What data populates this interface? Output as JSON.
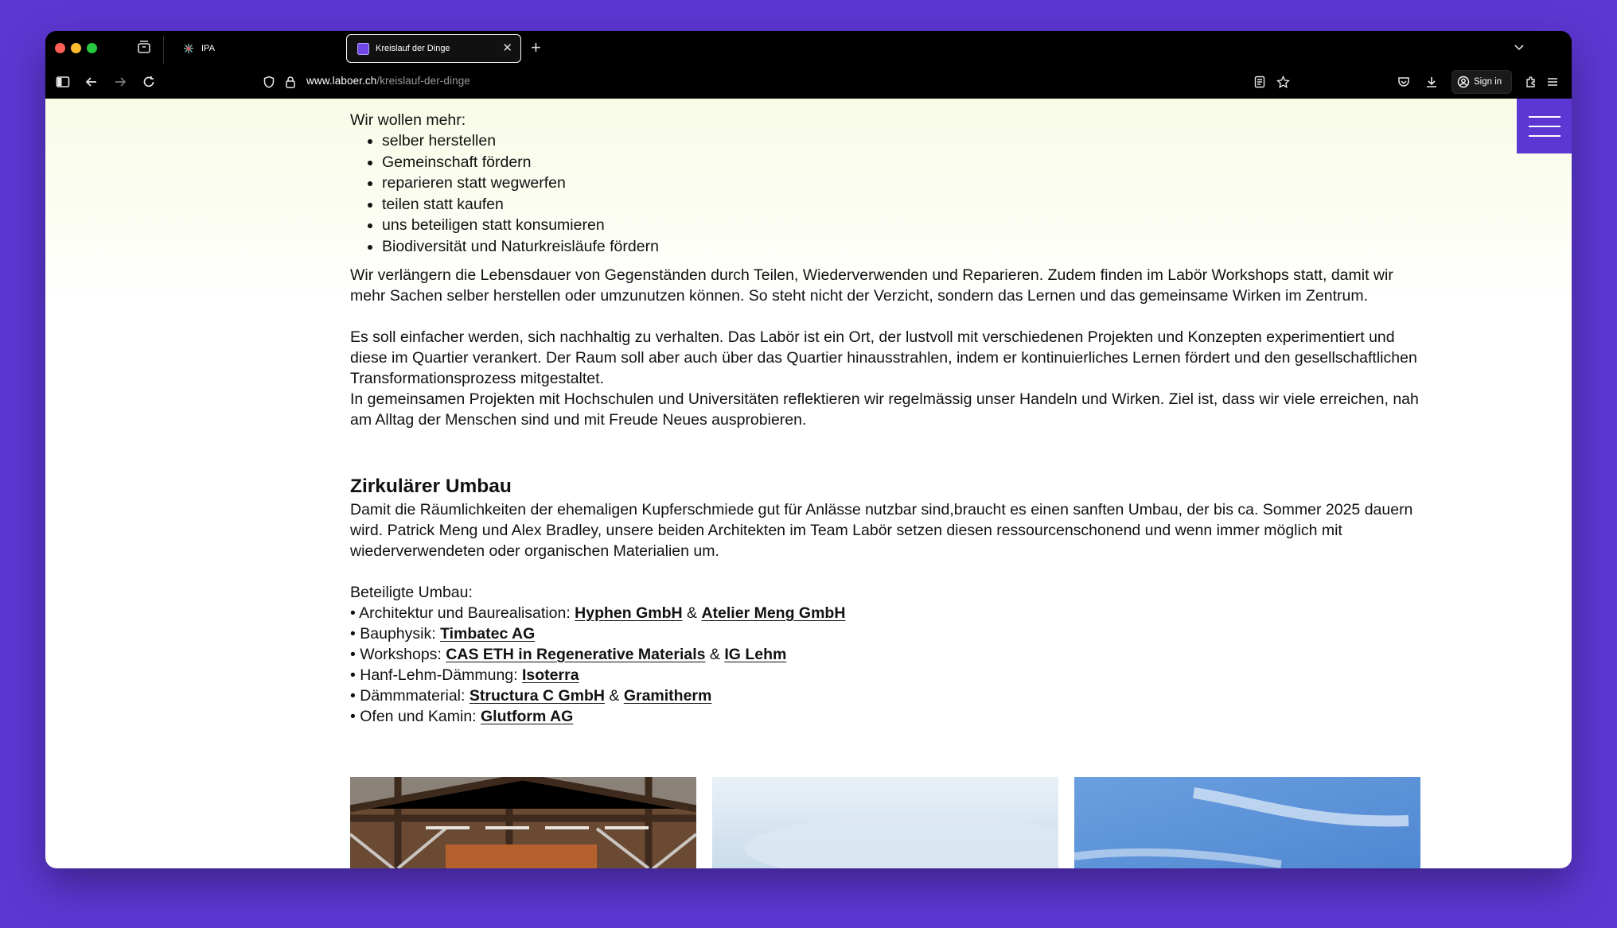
{
  "browser": {
    "tabs": [
      {
        "label": "IPA",
        "favicon": "sparkle-icon"
      },
      {
        "label": "Kreislauf der Dinge",
        "favicon": "purple-square-icon",
        "active": true
      }
    ],
    "url_domain": "www.laboer.ch",
    "url_path": "/kreislauf-der-dinge",
    "signin_label": "Sign in"
  },
  "content": {
    "intro_label": "Wir wollen mehr:",
    "goals": [
      "selber herstellen",
      "Gemeinschaft fördern",
      "reparieren statt wegwerfen",
      "teilen statt kaufen",
      "uns beteiligen statt konsumieren",
      "Biodiversität und Naturkreisläufe fördern"
    ],
    "para1": "Wir verlängern die Lebensdauer von Gegenständen durch Teilen, Wiederverwenden und Reparieren. Zudem finden im Labör Workshops statt, damit wir mehr Sachen selber herstellen oder umzunutzen können. So steht nicht der Verzicht, sondern das Lernen und das gemeinsame Wirken im Zentrum.",
    "para2": "Es soll einfacher werden, sich nachhaltig zu verhalten. Das Labör ist ein Ort, der lustvoll mit verschiedenen Projekten und Konzepten experimentiert und diese im Quartier verankert. Der Raum soll aber auch über das Quartier hinausstrahlen, indem er kontinuierliches Lernen fördert und den gesellschaftlichen Transformationsprozess mitgestaltet.",
    "para3": "In gemeinsamen Projekten mit Hochschulen und Universitäten reflektieren wir regelmässig unser Handeln und Wirken. Ziel ist, dass wir viele erreichen, nah am Alltag der Menschen sind und mit Freude Neues ausprobieren.",
    "heading": "Zirkulärer Umbau",
    "para4": "Damit die Räumlichkeiten der ehemaligen Kupferschmiede gut für Anlässe nutzbar sind,braucht es einen sanften Umbau, der bis ca. Sommer 2025 dauern wird. Patrick Meng und Alex Bradley, unsere beiden Architekten im Team Labör setzen diesen ressourcenschonend und wenn immer möglich mit wiederverwendeten oder organischen Materialien um.",
    "participants_label": "Beteiligte Umbau:",
    "bullet": "•",
    "amp": "&",
    "participants": [
      {
        "prefix": "Architektur und Baurealisation:",
        "links": [
          "Hyphen GmbH",
          "Atelier Meng GmbH"
        ]
      },
      {
        "prefix": "Bauphysik:",
        "links": [
          "Timbatec AG"
        ]
      },
      {
        "prefix": "Workshops:",
        "links": [
          "CAS ETH in Regenerative Materials",
          "IG Lehm"
        ]
      },
      {
        "prefix": "Hanf-Lehm-Dämmung:",
        "links": [
          "Isoterra"
        ]
      },
      {
        "prefix": "Dämmmaterial:",
        "links": [
          "Structura C GmbH",
          "Gramitherm"
        ]
      },
      {
        "prefix": "Ofen und Kamin:",
        "links": [
          "Glutform AG"
        ]
      }
    ]
  },
  "colors": {
    "accent": "#5d37d3",
    "page_top": "#f8fce6"
  }
}
